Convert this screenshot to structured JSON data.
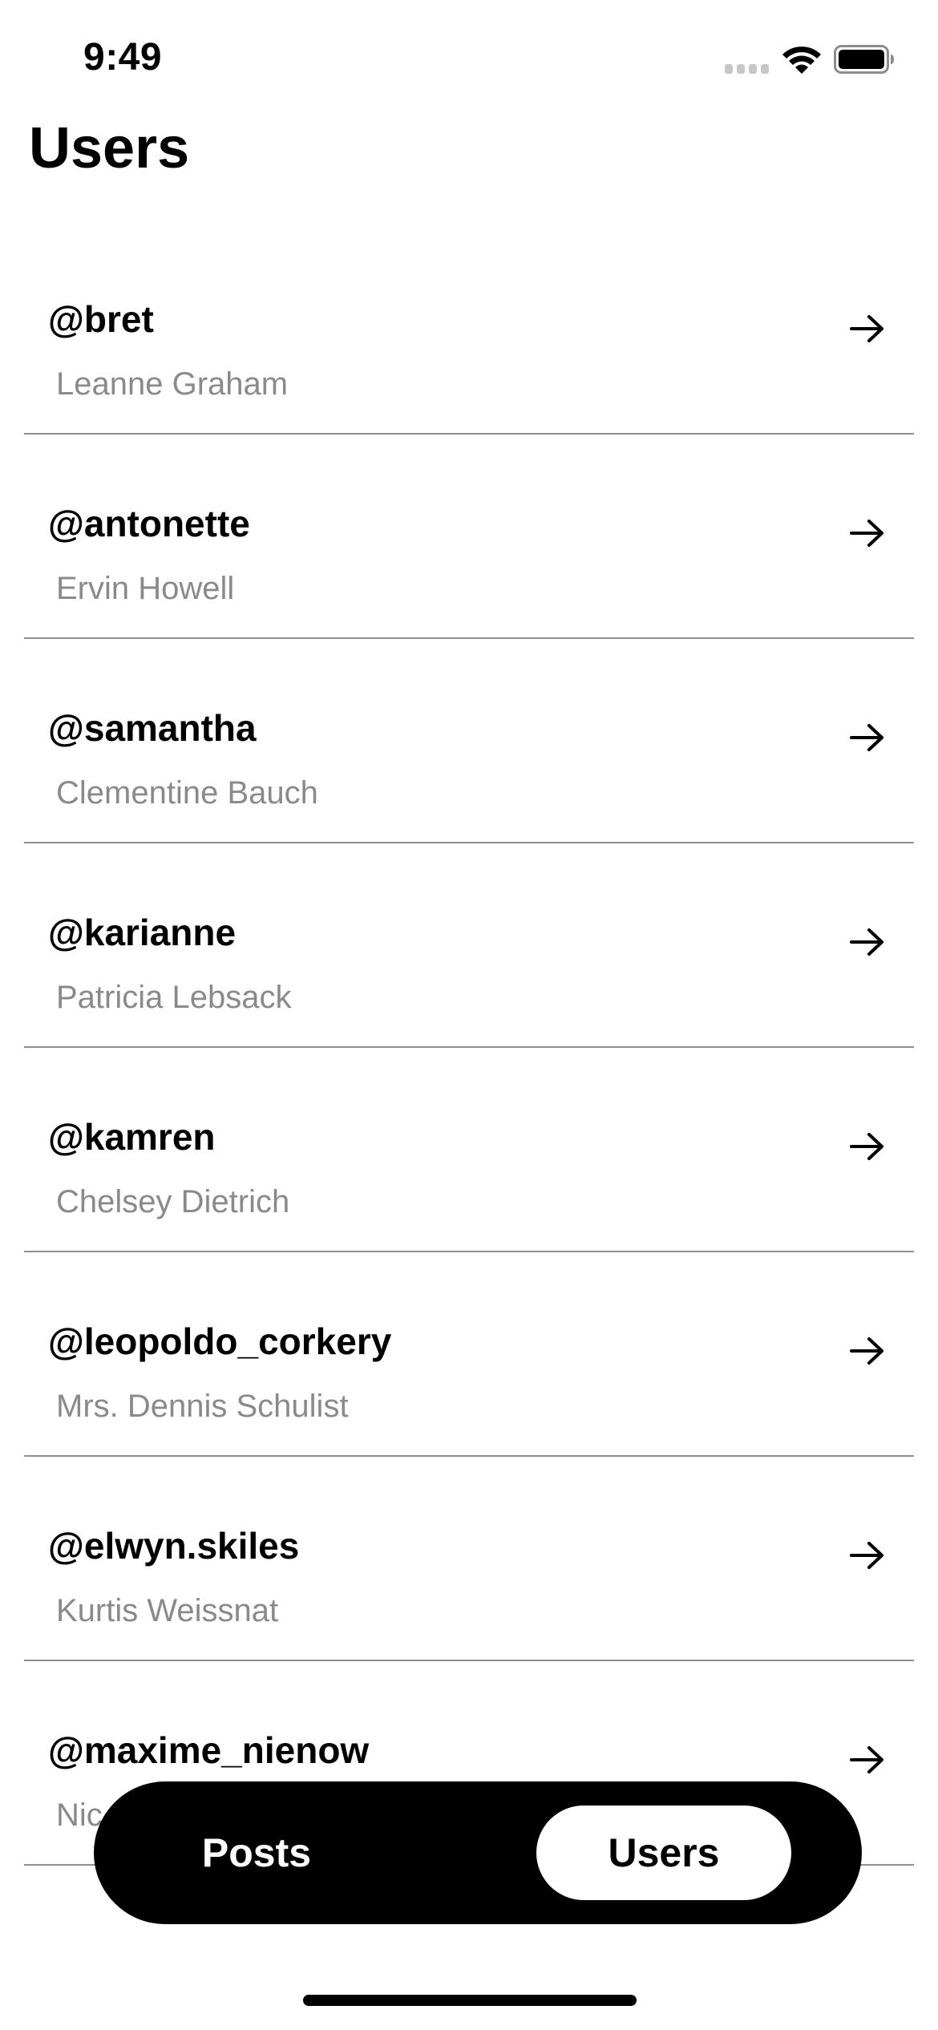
{
  "status_bar": {
    "time": "9:49",
    "icons": [
      "signal-icon",
      "wifi-icon",
      "battery-icon"
    ]
  },
  "header": {
    "title": "Users"
  },
  "users": [
    {
      "username": "@bret",
      "name": "Leanne Graham"
    },
    {
      "username": "@antonette",
      "name": "Ervin Howell"
    },
    {
      "username": "@samantha",
      "name": "Clementine Bauch"
    },
    {
      "username": "@karianne",
      "name": "Patricia Lebsack"
    },
    {
      "username": "@kamren",
      "name": "Chelsey Dietrich"
    },
    {
      "username": "@leopoldo_corkery",
      "name": "Mrs. Dennis Schulist"
    },
    {
      "username": "@elwyn.skiles",
      "name": "Kurtis Weissnat"
    },
    {
      "username": "@maxime_nienow",
      "name": "Nic"
    }
  ],
  "tab_bar": {
    "tabs": [
      {
        "label": "Posts",
        "selected": false
      },
      {
        "label": "Users",
        "selected": true
      }
    ]
  },
  "colors": {
    "background": "#ffffff",
    "text_primary": "#000000",
    "text_secondary": "#8a8a8a",
    "divider": "#8e8e8e",
    "tab_bar": "#000000",
    "tab_selected": "#ffffff"
  }
}
